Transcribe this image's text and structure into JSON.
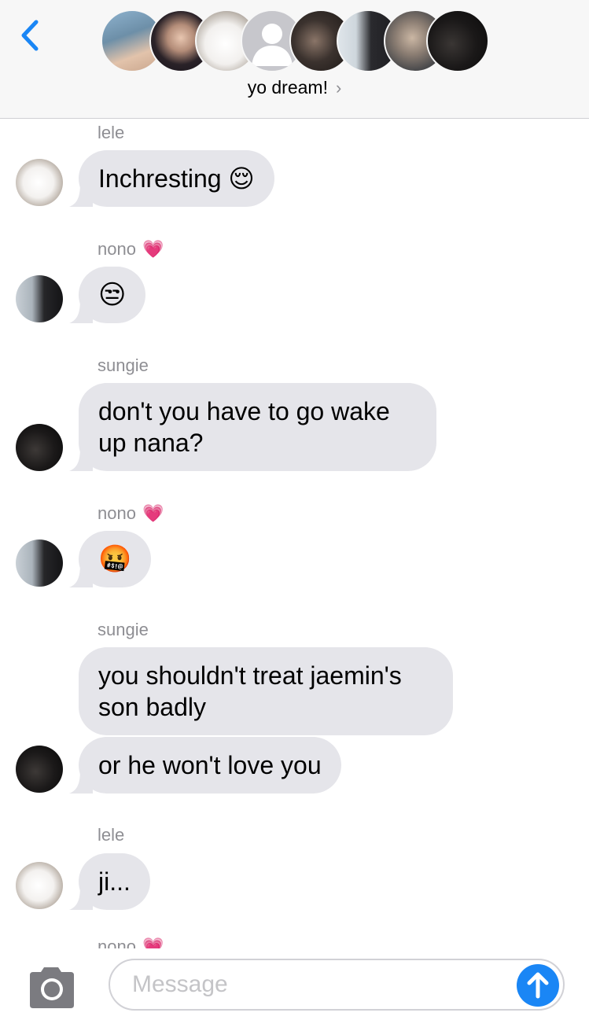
{
  "header": {
    "group_title": "yo dream!",
    "back_icon": "chevron-left-icon",
    "info_chevron": "›",
    "participants": [
      "photo-avatar",
      "photo-avatar",
      "dog-avatar",
      "placeholder-avatar",
      "photo-avatar",
      "photo-avatar",
      "photo-avatar",
      "photo-avatar"
    ]
  },
  "messages": [
    {
      "sender": "lele",
      "heart": "",
      "bubbles": [
        "Inchresting 😌"
      ],
      "avatar": "dog-avatar"
    },
    {
      "sender": "nono",
      "heart": "💗",
      "bubbles": [
        "😒"
      ],
      "avatar": "person-avatar"
    },
    {
      "sender": "sungie",
      "heart": "",
      "bubbles": [
        "don't you have to go wake up nana?"
      ],
      "avatar": "dark-avatar"
    },
    {
      "sender": "nono",
      "heart": "💗",
      "bubbles": [
        "🤬"
      ],
      "avatar": "person-avatar"
    },
    {
      "sender": "sungie",
      "heart": "",
      "bubbles": [
        "you shouldn't treat jaemin's son badly",
        "or he won't love you"
      ],
      "avatar": "dark-avatar"
    },
    {
      "sender": "lele",
      "heart": "",
      "bubbles": [
        "ji..."
      ],
      "avatar": "dog-avatar"
    },
    {
      "sender": "nono",
      "heart": "💗",
      "bubbles": [],
      "avatar": "person-avatar"
    }
  ],
  "compose": {
    "placeholder": "Message",
    "camera_icon": "camera-icon",
    "send_icon": "arrow-up-icon"
  },
  "colors": {
    "accent": "#1a86f5",
    "bubble_gray": "#e5e5ea",
    "sender_gray": "#8e8e93",
    "header_bg": "#f7f7f7"
  }
}
